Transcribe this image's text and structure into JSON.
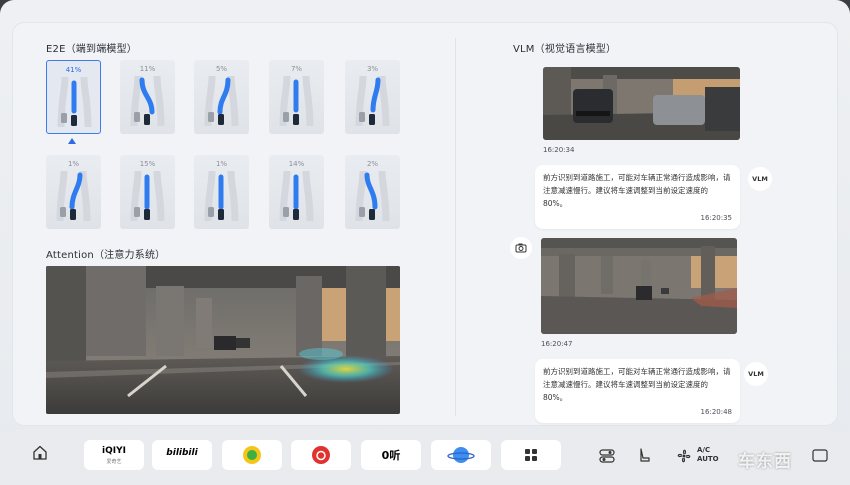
{
  "e2e": {
    "title": "E2E（端到端模型）",
    "tiles": [
      {
        "pct": "41%",
        "selected": true
      },
      {
        "pct": "11%",
        "selected": false
      },
      {
        "pct": "5%",
        "selected": false
      },
      {
        "pct": "7%",
        "selected": false
      },
      {
        "pct": "3%",
        "selected": false
      },
      {
        "pct": "1%",
        "selected": false
      },
      {
        "pct": "15%",
        "selected": false
      },
      {
        "pct": "1%",
        "selected": false
      },
      {
        "pct": "14%",
        "selected": false
      },
      {
        "pct": "2%",
        "selected": false
      }
    ]
  },
  "attention": {
    "title": "Attention（注意力系统）"
  },
  "vlm": {
    "title": "VLM（视觉语言模型）",
    "badge": "VLM",
    "messages": [
      {
        "image_time": "16:20:34",
        "text": "前方识别到道路施工，可能对车辆正常通行造成影响，请注意减速慢行。建议将车速调整到当前设定速度的80%。",
        "reply_time": "16:20:35"
      },
      {
        "image_time": "16:20:47",
        "text": "前方识别到道路施工，可能对车辆正常通行造成影响，请注意减速慢行。建议将车速调整到当前设定速度的80%。",
        "reply_time": "16:20:48"
      }
    ]
  },
  "dock": {
    "apps": [
      {
        "name": "iqiyi",
        "label": "iQIYI",
        "sub": "爱奇艺",
        "color": "#1db53a"
      },
      {
        "name": "bilibili",
        "label": "bilibili",
        "color": "#f36f9a"
      },
      {
        "name": "qq-music",
        "label": "",
        "color": "#f5c518"
      },
      {
        "name": "netease-music",
        "label": "",
        "color": "#e0332f"
      },
      {
        "name": "ting",
        "label": "0听",
        "color": "#e24a2c"
      },
      {
        "name": "planet",
        "label": "",
        "color": "#3d8ef0"
      },
      {
        "name": "app-grid",
        "label": "",
        "color": "#333333"
      }
    ],
    "ac": {
      "line1": "A/C",
      "line2": "AUTO"
    }
  },
  "watermark": "车东西",
  "colors": {
    "accent": "#2e6be6",
    "lane_blue": "#2f7cf0"
  }
}
